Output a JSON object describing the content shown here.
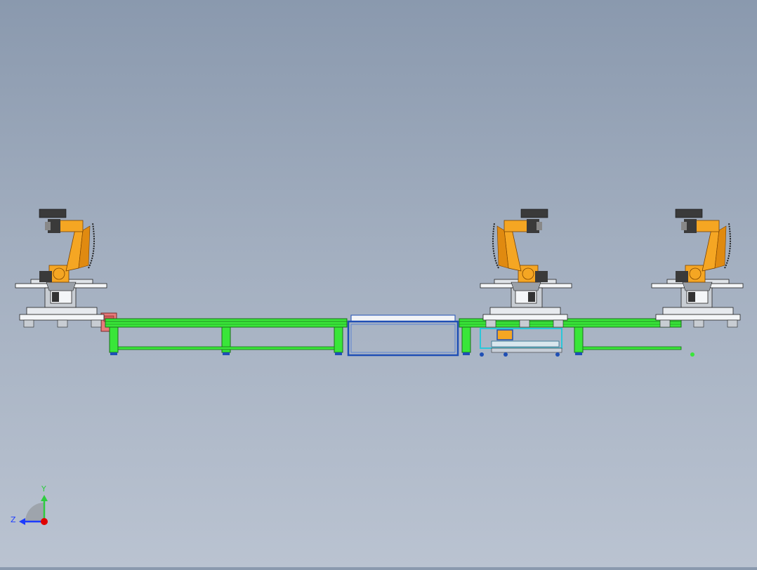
{
  "viewport": {
    "background_top": "#8a99ae",
    "background_bottom": "#bac3d1"
  },
  "colors": {
    "conveyor": "#39e639",
    "conveyor_dark": "#1e9e1e",
    "robot": "#f5a623",
    "robot_dark": "#c46d00",
    "frame_blue": "#1f4fb5",
    "cyan_frame": "#2cc6d9",
    "gray_metal": "#8c8c8c",
    "dark_part": "#3a3a3a",
    "pink_motor": "#e77a7a"
  },
  "triad": {
    "y_label": "Y",
    "z_label": "Z",
    "y_axis_color": "#2ecc40",
    "z_axis_color": "#1e3cff",
    "origin_color": "#e00000"
  },
  "scene": {
    "robots": [
      {
        "name": "robot-left",
        "mirrored": false
      },
      {
        "name": "robot-middle",
        "mirrored": true
      },
      {
        "name": "robot-right",
        "mirrored": false
      }
    ],
    "conveyors": [
      "conveyor-left",
      "conveyor-right"
    ],
    "center_station": "transfer-frame"
  }
}
